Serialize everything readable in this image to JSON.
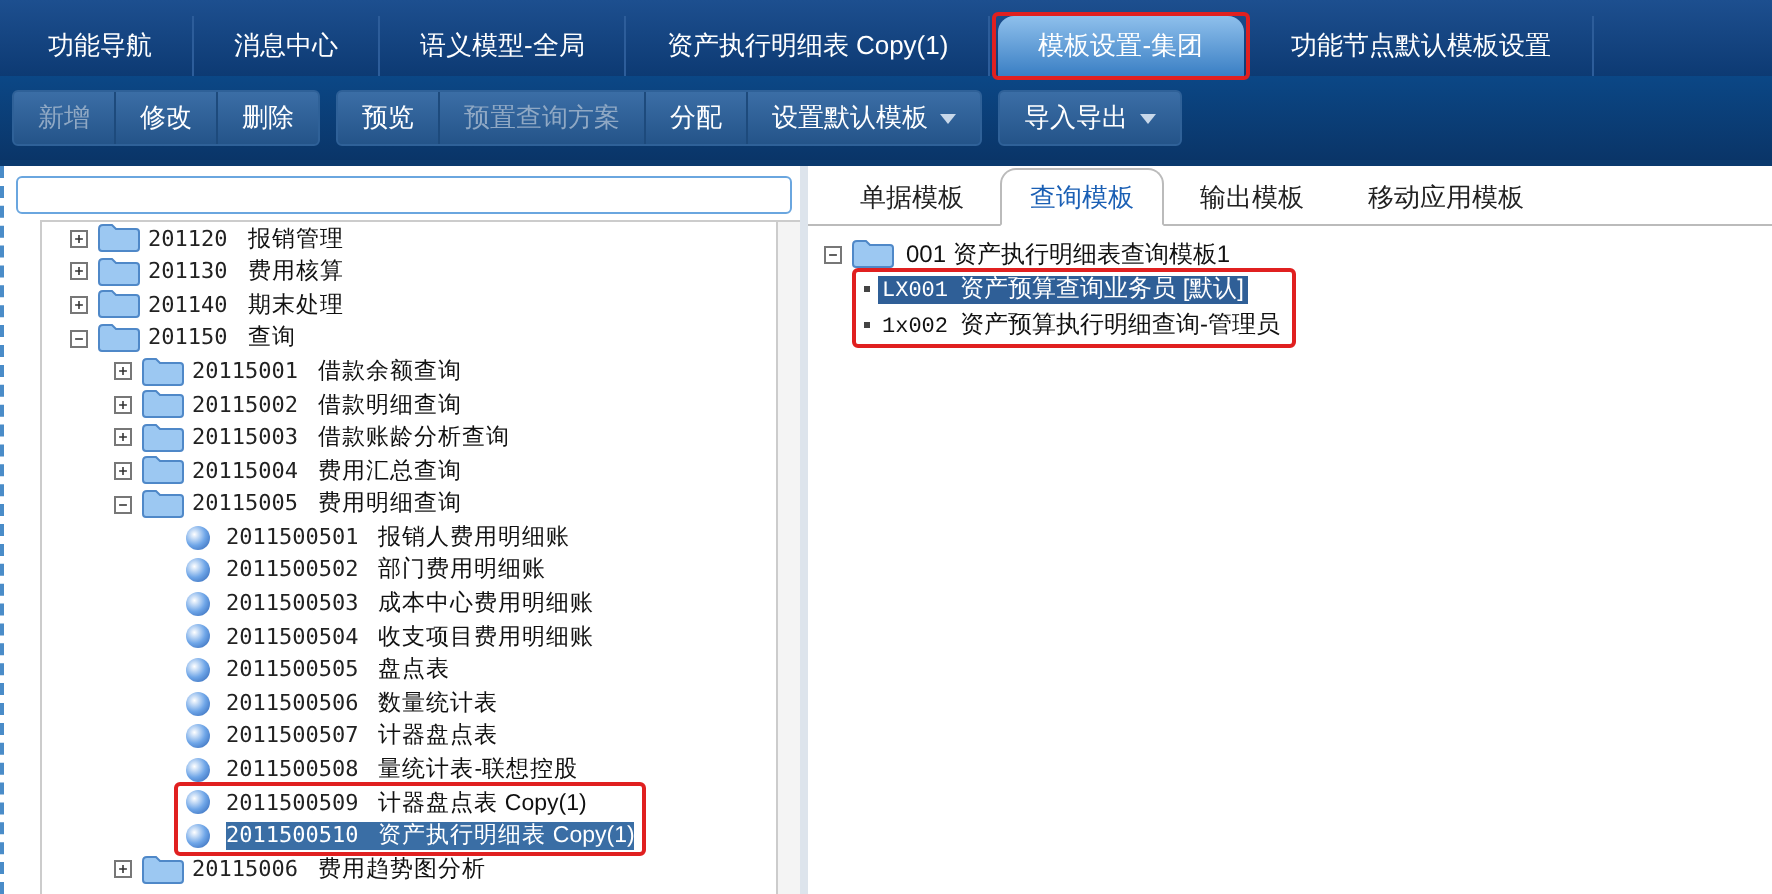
{
  "top_tabs": [
    {
      "label": "功能导航",
      "selected": false
    },
    {
      "label": "消息中心",
      "selected": false
    },
    {
      "label": "语义模型-全局",
      "selected": false
    },
    {
      "label": "资产执行明细表 Copy(1)",
      "selected": false
    },
    {
      "label": "模板设置-集团",
      "selected": true
    },
    {
      "label": "功能节点默认模板设置",
      "selected": false
    }
  ],
  "toolbar": [
    [
      {
        "label": "新增",
        "disabled": true,
        "dropdown": false
      },
      {
        "label": "修改",
        "disabled": false,
        "dropdown": false
      },
      {
        "label": "删除",
        "disabled": false,
        "dropdown": false
      }
    ],
    [
      {
        "label": "预览",
        "disabled": false,
        "dropdown": false
      },
      {
        "label": "预置查询方案",
        "disabled": true,
        "dropdown": false
      },
      {
        "label": "分配",
        "disabled": false,
        "dropdown": false
      },
      {
        "label": "设置默认模板",
        "disabled": false,
        "dropdown": true
      }
    ],
    [
      {
        "label": "导入导出",
        "disabled": false,
        "dropdown": true
      }
    ]
  ],
  "left_tree": {
    "items": [
      {
        "kind": "folder",
        "code": "201120",
        "name": "报销管理",
        "expanded": false,
        "selected": false
      },
      {
        "kind": "folder",
        "code": "201130",
        "name": "费用核算",
        "expanded": false,
        "selected": false
      },
      {
        "kind": "folder",
        "code": "201140",
        "name": "期末处理",
        "expanded": false,
        "selected": false
      },
      {
        "kind": "folder",
        "code": "201150",
        "name": "查询",
        "expanded": true,
        "selected": false,
        "children": [
          {
            "kind": "folder",
            "code": "20115001",
            "name": "借款余额查询",
            "expanded": false,
            "selected": false
          },
          {
            "kind": "folder",
            "code": "20115002",
            "name": "借款明细查询",
            "expanded": false,
            "selected": false
          },
          {
            "kind": "folder",
            "code": "20115003",
            "name": "借款账龄分析查询",
            "expanded": false,
            "selected": false
          },
          {
            "kind": "folder",
            "code": "20115004",
            "name": "费用汇总查询",
            "expanded": false,
            "selected": false
          },
          {
            "kind": "folder",
            "code": "20115005",
            "name": "费用明细查询",
            "expanded": true,
            "selected": false,
            "children": [
              {
                "kind": "leaf",
                "code": "2011500501",
                "name": "报销人费用明细账",
                "selected": false
              },
              {
                "kind": "leaf",
                "code": "2011500502",
                "name": "部门费用明细账",
                "selected": false
              },
              {
                "kind": "leaf",
                "code": "2011500503",
                "name": "成本中心费用明细账",
                "selected": false
              },
              {
                "kind": "leaf",
                "code": "2011500504",
                "name": "收支项目费用明细账",
                "selected": false
              },
              {
                "kind": "leaf",
                "code": "2011500505",
                "name": "盘点表",
                "selected": false
              },
              {
                "kind": "leaf",
                "code": "2011500506",
                "name": "数量统计表",
                "selected": false
              },
              {
                "kind": "leaf",
                "code": "2011500507",
                "name": "计器盘点表",
                "selected": false
              },
              {
                "kind": "leaf",
                "code": "2011500508",
                "name": "量统计表-联想控股",
                "selected": false
              },
              {
                "kind": "leaf",
                "code": "2011500509",
                "name": "计器盘点表 Copy(1)",
                "selected": false
              },
              {
                "kind": "leaf",
                "code": "2011500510",
                "name": "资产执行明细表 Copy(1)",
                "selected": true
              }
            ]
          },
          {
            "kind": "folder",
            "code": "20115006",
            "name": "费用趋势图分析",
            "expanded": false,
            "selected": false
          }
        ]
      }
    ]
  },
  "right_panel": {
    "tabs": [
      {
        "label": "单据模板",
        "selected": false
      },
      {
        "label": "查询模板",
        "selected": true
      },
      {
        "label": "输出模板",
        "selected": false
      },
      {
        "label": "移动应用模板",
        "selected": false
      }
    ],
    "tree": {
      "kind": "folder",
      "code": "001",
      "name": "资产执行明细表查询模板1",
      "expanded": true,
      "children": [
        {
          "code": "LX001",
          "name": "资产预算查询业务员 [默认]",
          "selected": true
        },
        {
          "code": "1x002",
          "name": "资产预算执行明细查询-管理员",
          "selected": false
        }
      ]
    }
  }
}
